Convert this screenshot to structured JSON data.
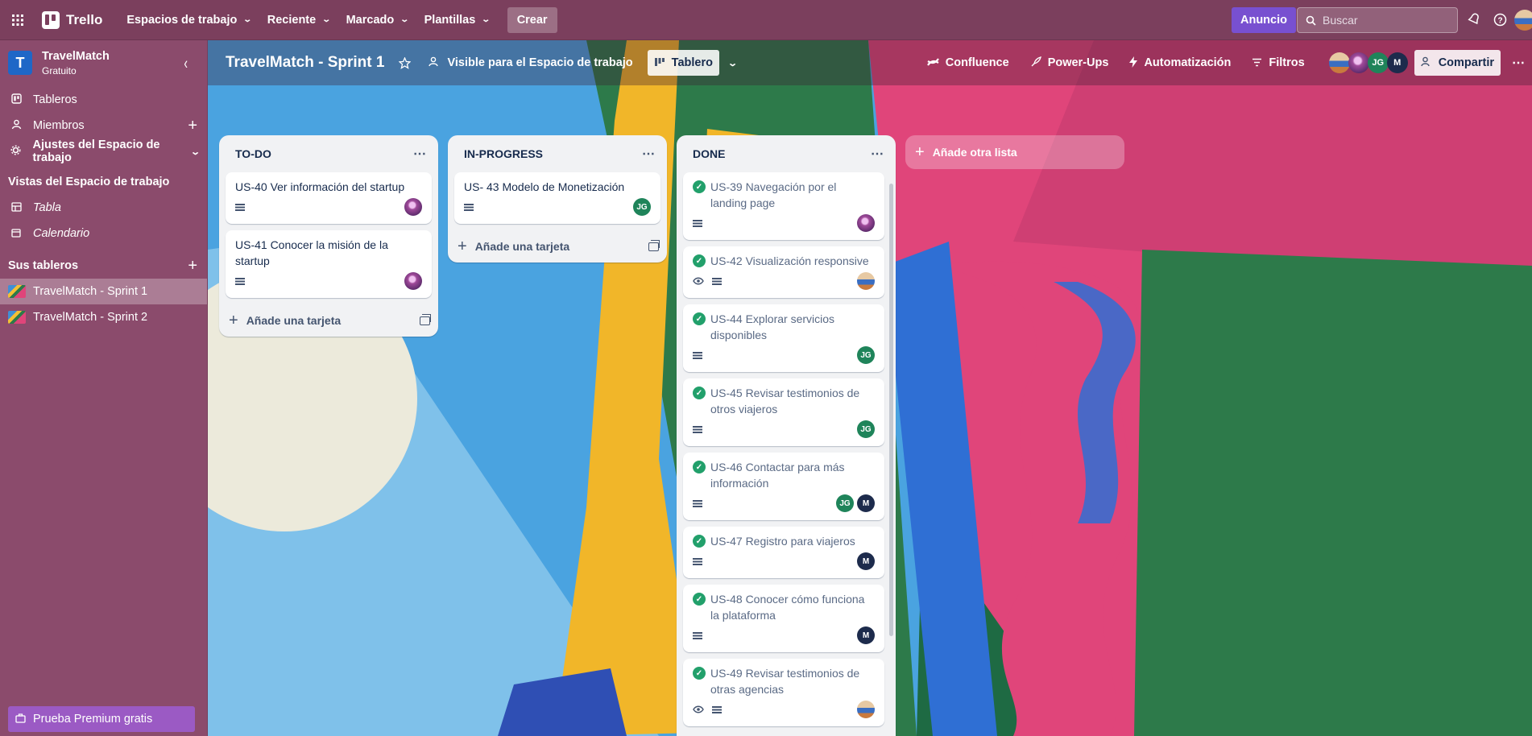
{
  "header": {
    "app_name": "Trello",
    "menus": [
      "Espacios de trabajo",
      "Reciente",
      "Marcado",
      "Plantillas"
    ],
    "create_label": "Crear",
    "announcement_label": "Anuncio",
    "search_placeholder": "Buscar"
  },
  "sidebar": {
    "workspace_initial": "T",
    "workspace_name": "TravelMatch",
    "workspace_plan": "Gratuito",
    "items": [
      {
        "label": "Tableros"
      },
      {
        "label": "Miembros"
      },
      {
        "label": "Ajustes del Espacio de trabajo"
      }
    ],
    "views_heading": "Vistas del Espacio de trabajo",
    "views": [
      {
        "label": "Tabla"
      },
      {
        "label": "Calendario"
      }
    ],
    "boards_heading": "Sus tableros",
    "boards": [
      {
        "label": "TravelMatch - Sprint 1"
      },
      {
        "label": "TravelMatch - Sprint 2"
      }
    ],
    "premium_label": "Prueba Premium gratis"
  },
  "board": {
    "title": "TravelMatch - Sprint 1",
    "visibility": "Visible para el Espacio de trabajo",
    "view_label": "Tablero",
    "tools": [
      "Confluence",
      "Power-Ups",
      "Automatización",
      "Filtros"
    ],
    "member_initials": [
      "JG",
      "M"
    ],
    "share_label": "Compartir",
    "add_list_label": "Añade otra lista",
    "add_card_label": "Añade una tarjeta",
    "lists": [
      {
        "title": "TO-DO",
        "cards": [
          {
            "title": "US-40 Ver información del startup",
            "members": [
              "p1"
            ]
          },
          {
            "title": "US-41 Conocer la misión de la startup",
            "members": [
              "p1"
            ]
          }
        ]
      },
      {
        "title": "IN-PROGRESS",
        "cards": [
          {
            "title": "US- 43 Modelo de Monetización",
            "members": [
              "JG"
            ]
          }
        ]
      },
      {
        "title": "DONE",
        "cards": [
          {
            "title": "US-39 Navegación por el landing page",
            "members": [
              "p1"
            ]
          },
          {
            "title": "US-42 Visualización responsive",
            "members": [
              "p2"
            ],
            "watch": true
          },
          {
            "title": "US-44 Explorar servicios disponibles",
            "members": [
              "JG"
            ]
          },
          {
            "title": "US-45 Revisar testimonios de otros viajeros",
            "members": [
              "JG"
            ]
          },
          {
            "title": "US-46 Contactar para más información",
            "members": [
              "JG",
              "M"
            ]
          },
          {
            "title": "US-47 Registro para viajeros",
            "members": [
              "M"
            ]
          },
          {
            "title": "US-48 Conocer cómo funciona la plataforma",
            "members": [
              "M"
            ]
          },
          {
            "title": "US-49 Revisar testimonios de otras agencias",
            "members": [
              "p2"
            ],
            "watch": true
          }
        ]
      }
    ]
  }
}
